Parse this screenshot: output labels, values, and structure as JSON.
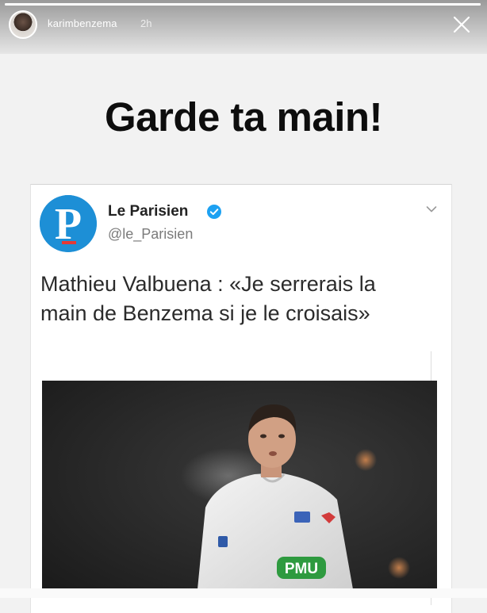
{
  "story": {
    "username": "karimbenzema",
    "timestamp": "2h",
    "caption": "Garde ta main!",
    "progress": 1.0
  },
  "tweet": {
    "account_name": "Le Parisien",
    "handle": "@le_Parisien",
    "text": "Mathieu Valbuena : «Je serrerais la main de Benzema si je le croisais»",
    "logo_letter": "P",
    "photo": {
      "jersey_text": "PMU"
    }
  },
  "icons": {
    "close": "close-icon",
    "verified": "verified-badge-icon",
    "menu": "chevron-down-icon"
  },
  "colors": {
    "parisien_blue": "#1d8fd6",
    "verified_blue": "#1da1f2",
    "caption_text": "#0d0d0d",
    "pmu_green": "#2e9a3f"
  }
}
